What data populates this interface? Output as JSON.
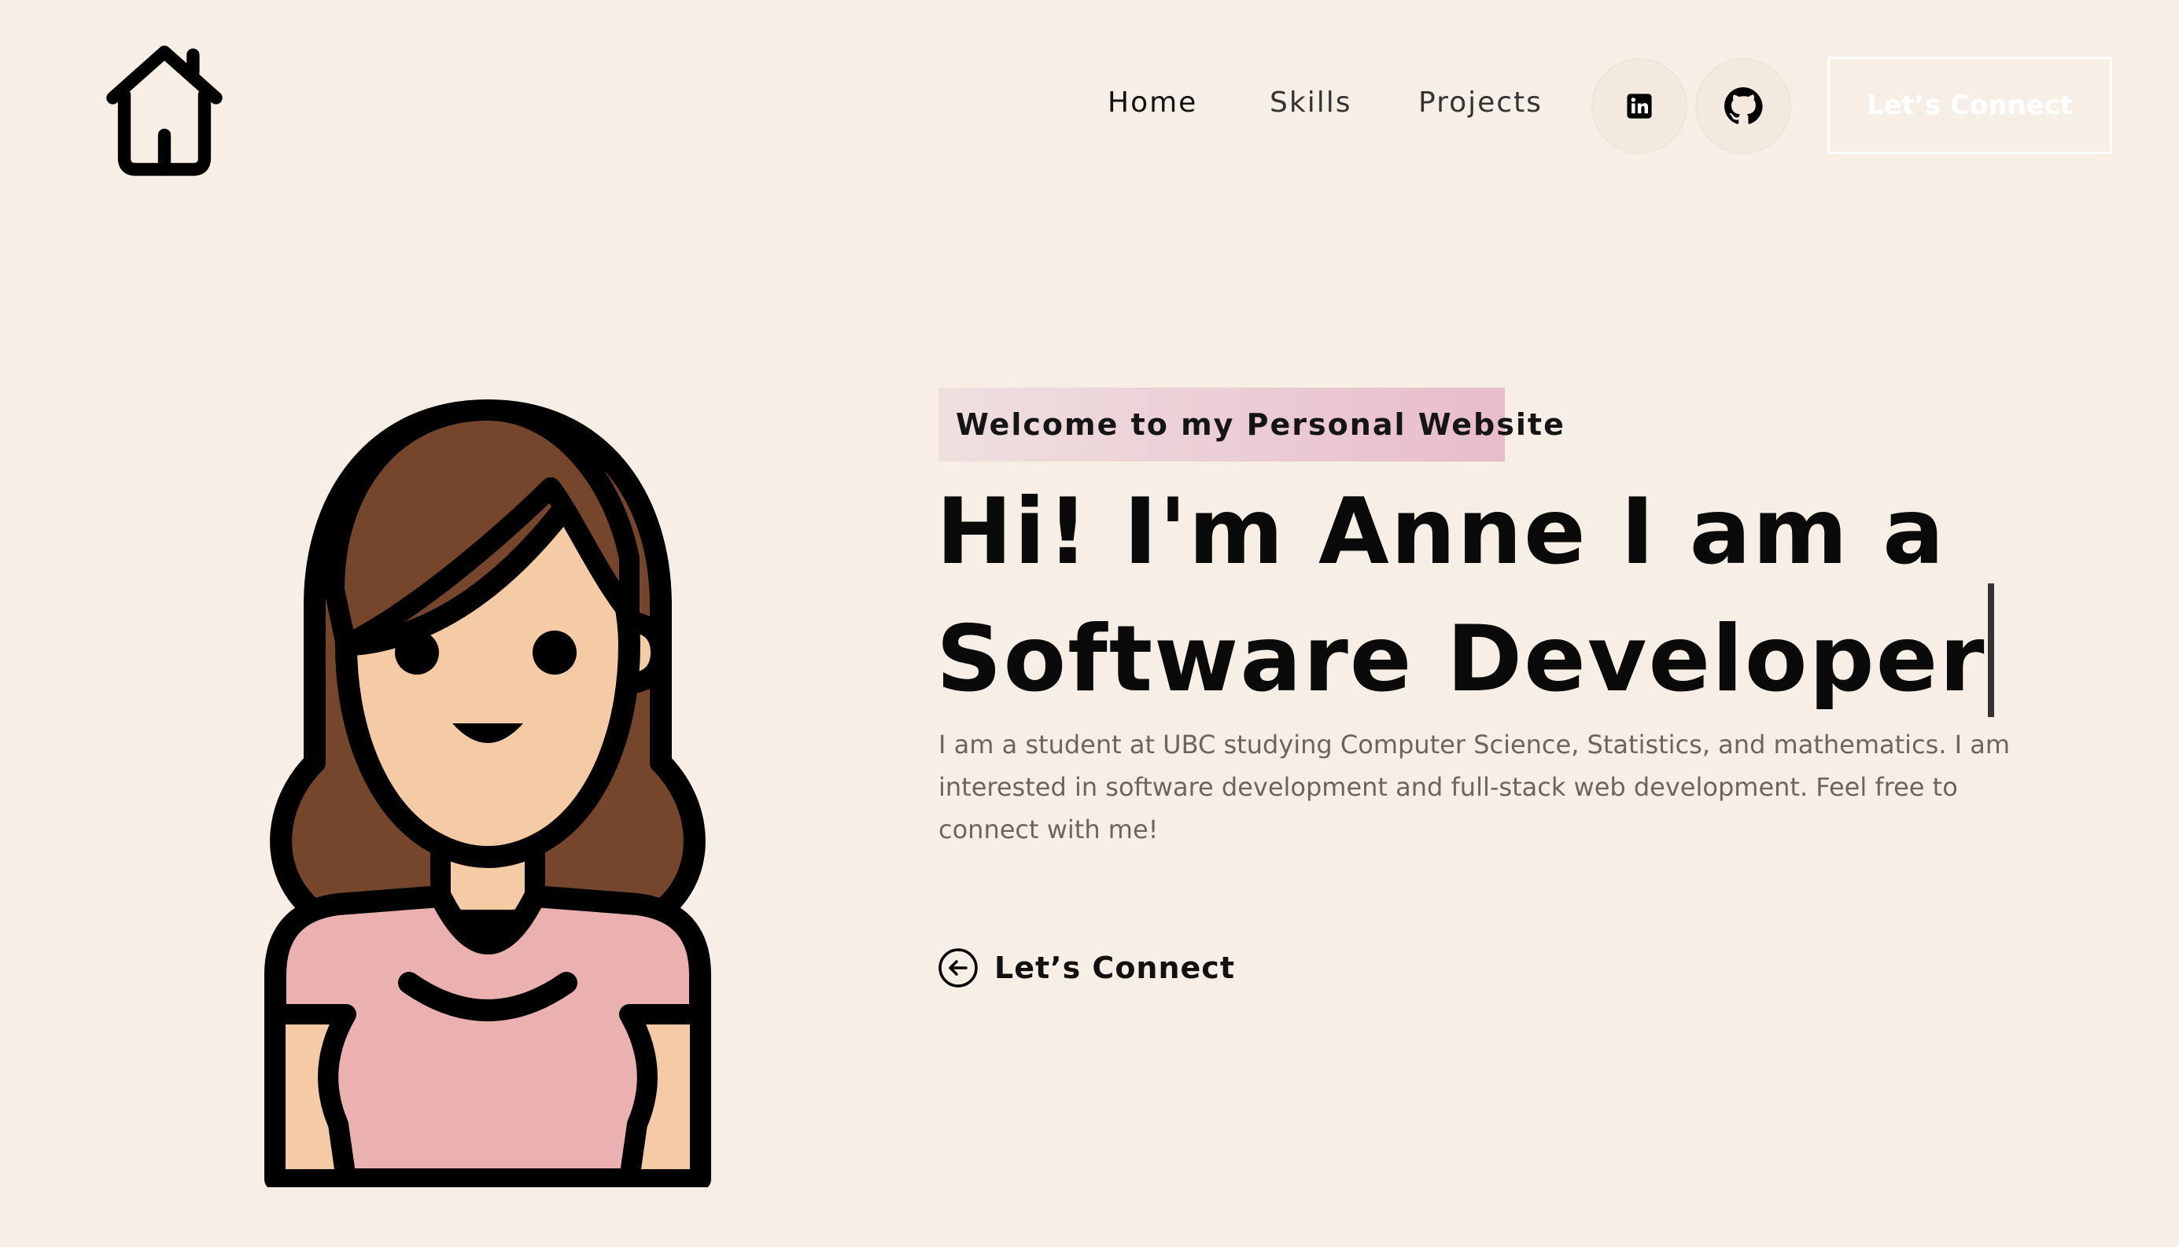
{
  "nav": {
    "logo_icon": "home-icon",
    "links": [
      {
        "label": "Home"
      },
      {
        "label": "Skills"
      },
      {
        "label": "Projects"
      }
    ],
    "social": [
      {
        "icon": "linkedin-icon"
      },
      {
        "icon": "github-icon"
      }
    ],
    "connect_label": "Let’s Connect"
  },
  "hero": {
    "tagline": "Welcome to my Personal Website",
    "headline_line1": "Hi! I'm Anne I am a",
    "headline_line2": "Software Developer",
    "intro": "I am a student at UBC studying Computer Science, Statistics, and mathematics. I am interested in software development and full-stack web development. Feel free to connect with me!",
    "cta_label": "Let’s Connect",
    "cta_icon": "arrow-left-circle-icon"
  },
  "colors": {
    "background": "#f7efe6",
    "tagline_gradient_start": "#efe0e0",
    "tagline_gradient_end": "#e8bccb",
    "hair": "#75452c",
    "skin": "#f5cba6",
    "shirt": "#ebb1b1"
  }
}
